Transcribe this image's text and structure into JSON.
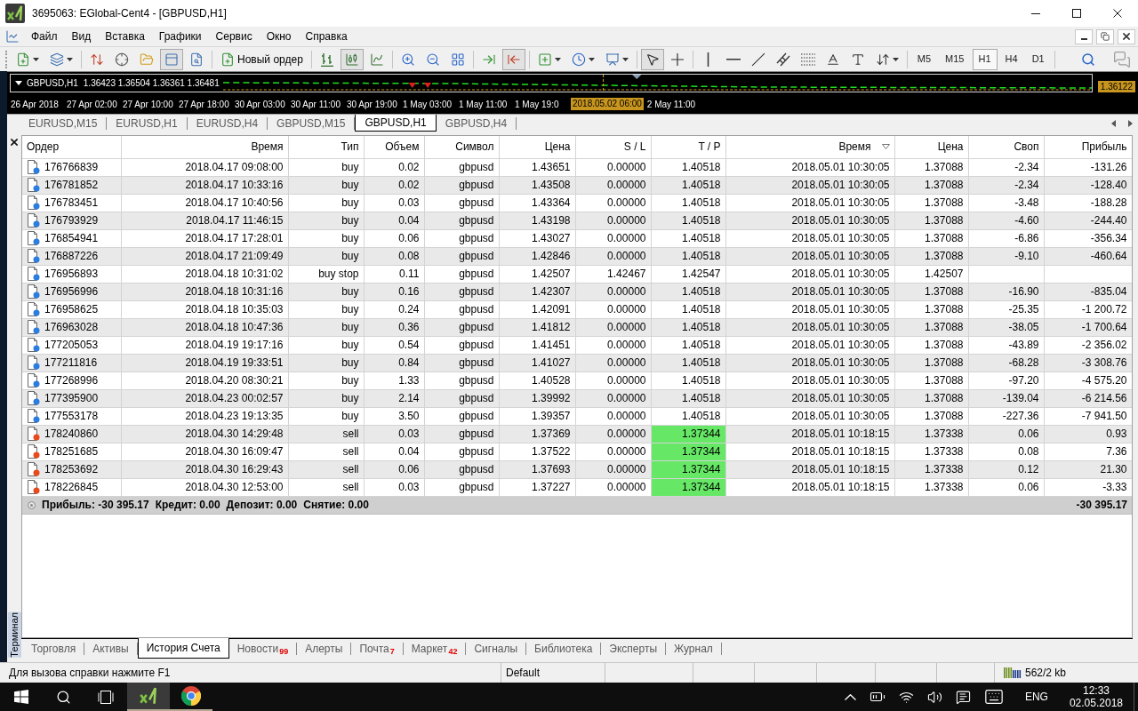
{
  "window": {
    "title": "3695063: EGlobal-Cent4 - [GBPUSD,H1]"
  },
  "menu": {
    "items": [
      "Файл",
      "Вид",
      "Вставка",
      "Графики",
      "Сервис",
      "Окно",
      "Справка"
    ]
  },
  "toolbar": {
    "groups": [
      [
        {
          "kind": "new-chart",
          "pressed": false,
          "dropdown": true
        },
        {
          "kind": "profiles",
          "pressed": false,
          "dropdown": true
        }
      ],
      [
        {
          "kind": "market-watch",
          "pressed": false,
          "dropdown": false
        },
        {
          "kind": "data-window",
          "pressed": false,
          "dropdown": false
        },
        {
          "kind": "navigator",
          "pressed": false,
          "dropdown": false
        },
        {
          "kind": "terminal",
          "pressed": true,
          "dropdown": false
        },
        {
          "kind": "tester",
          "pressed": false,
          "dropdown": false
        }
      ],
      [
        {
          "kind": "new-order",
          "label": "Новый ордер",
          "pressed": false,
          "dropdown": false
        }
      ],
      [
        {
          "kind": "bar-chart",
          "pressed": false,
          "dropdown": false
        },
        {
          "kind": "candles",
          "pressed": true,
          "dropdown": false
        },
        {
          "kind": "line-chart",
          "pressed": false,
          "dropdown": false
        }
      ],
      [
        {
          "kind": "zoom-in",
          "pressed": false,
          "dropdown": false
        },
        {
          "kind": "zoom-out",
          "pressed": false,
          "dropdown": false
        },
        {
          "kind": "tile",
          "pressed": false,
          "dropdown": false
        }
      ],
      [
        {
          "kind": "chart-shift",
          "pressed": false,
          "dropdown": false
        },
        {
          "kind": "autoscroll",
          "pressed": true,
          "dropdown": false
        }
      ],
      [
        {
          "kind": "indicators",
          "pressed": false,
          "dropdown": true
        },
        {
          "kind": "periods",
          "pressed": false,
          "dropdown": true
        },
        {
          "kind": "templates",
          "pressed": false,
          "dropdown": true
        }
      ],
      [
        {
          "kind": "cursor",
          "pressed": true,
          "dropdown": false
        },
        {
          "kind": "crosshair",
          "pressed": false,
          "dropdown": false
        }
      ],
      [
        {
          "kind": "vline",
          "pressed": false,
          "dropdown": false
        },
        {
          "kind": "hline",
          "pressed": false,
          "dropdown": false
        },
        {
          "kind": "trendline",
          "pressed": false,
          "dropdown": false
        },
        {
          "kind": "channel",
          "pressed": false,
          "dropdown": false
        },
        {
          "kind": "fibo",
          "pressed": false,
          "dropdown": false
        },
        {
          "kind": "text",
          "pressed": false,
          "dropdown": false
        },
        {
          "kind": "label",
          "pressed": false,
          "dropdown": false
        },
        {
          "kind": "arrows",
          "pressed": false,
          "dropdown": true
        }
      ]
    ],
    "timeframes": [
      {
        "label": "M5",
        "selected": false
      },
      {
        "label": "M15",
        "selected": false
      },
      {
        "label": "H1",
        "selected": true
      },
      {
        "label": "H4",
        "selected": false
      },
      {
        "label": "D1",
        "selected": false
      }
    ]
  },
  "chart": {
    "symbol": "GBPUSD,H1",
    "prices": "1.36423 1.36504 1.36361 1.36481",
    "price_tag": "1.36122",
    "time_labels": [
      "26 Apr 2018",
      "27 Apr 02:00",
      "27 Apr 10:00",
      "27 Apr 18:00",
      "30 Apr 03:00",
      "30 Apr 11:00",
      "30 Apr 19:00",
      "1 May 03:00",
      "1 May 11:00",
      "1 May 19:0"
    ],
    "cursor_time": "2018.05.02 06:00",
    "time_labels_after": [
      "2 May 11:00"
    ]
  },
  "chart_tabs": [
    {
      "label": "EURUSD,M15",
      "selected": false
    },
    {
      "label": "EURUSD,H1",
      "selected": false
    },
    {
      "label": "EURUSD,H4",
      "selected": false
    },
    {
      "label": "GBPUSD,M15",
      "selected": false
    },
    {
      "label": "GBPUSD,H1",
      "selected": true
    },
    {
      "label": "GBPUSD,H4",
      "selected": false
    }
  ],
  "terminal": {
    "title": "Терминал",
    "columns": [
      {
        "label": "Ордер",
        "sorted": false
      },
      {
        "label": "Время",
        "sorted": false
      },
      {
        "label": "Тип",
        "sorted": false
      },
      {
        "label": "Объем",
        "sorted": false
      },
      {
        "label": "Символ",
        "sorted": false
      },
      {
        "label": "Цена",
        "sorted": false
      },
      {
        "label": "S / L",
        "sorted": false
      },
      {
        "label": "T / P",
        "sorted": false
      },
      {
        "label": "Время",
        "sorted": true
      },
      {
        "label": "Цена",
        "sorted": false
      },
      {
        "label": "Своп",
        "sorted": false
      },
      {
        "label": "Прибыль",
        "sorted": false
      }
    ],
    "rows": [
      {
        "kind": "buy",
        "tp_highlighted": false,
        "cells": [
          "176766839",
          "2018.04.17 09:08:00",
          "buy",
          "0.02",
          "gbpusd",
          "1.43651",
          "0.00000",
          "1.40518",
          "2018.05.01 10:30:05",
          "1.37088",
          "-2.34",
          "-131.26"
        ]
      },
      {
        "kind": "buy",
        "tp_highlighted": false,
        "cells": [
          "176781852",
          "2018.04.17 10:33:16",
          "buy",
          "0.02",
          "gbpusd",
          "1.43508",
          "0.00000",
          "1.40518",
          "2018.05.01 10:30:05",
          "1.37088",
          "-2.34",
          "-128.40"
        ]
      },
      {
        "kind": "buy",
        "tp_highlighted": false,
        "cells": [
          "176783451",
          "2018.04.17 10:40:56",
          "buy",
          "0.03",
          "gbpusd",
          "1.43364",
          "0.00000",
          "1.40518",
          "2018.05.01 10:30:05",
          "1.37088",
          "-3.48",
          "-188.28"
        ]
      },
      {
        "kind": "buy",
        "tp_highlighted": false,
        "cells": [
          "176793929",
          "2018.04.17 11:46:15",
          "buy",
          "0.04",
          "gbpusd",
          "1.43198",
          "0.00000",
          "1.40518",
          "2018.05.01 10:30:05",
          "1.37088",
          "-4.60",
          "-244.40"
        ]
      },
      {
        "kind": "buy",
        "tp_highlighted": false,
        "cells": [
          "176854941",
          "2018.04.17 17:28:01",
          "buy",
          "0.06",
          "gbpusd",
          "1.43027",
          "0.00000",
          "1.40518",
          "2018.05.01 10:30:05",
          "1.37088",
          "-6.86",
          "-356.34"
        ]
      },
      {
        "kind": "buy",
        "tp_highlighted": false,
        "cells": [
          "176887226",
          "2018.04.17 21:09:49",
          "buy",
          "0.08",
          "gbpusd",
          "1.42846",
          "0.00000",
          "1.40518",
          "2018.05.01 10:30:05",
          "1.37088",
          "-9.10",
          "-460.64"
        ]
      },
      {
        "kind": "buy",
        "tp_highlighted": false,
        "cells": [
          "176956893",
          "2018.04.18 10:31:02",
          "buy stop",
          "0.11",
          "gbpusd",
          "1.42507",
          "1.42467",
          "1.42547",
          "2018.05.01 10:30:05",
          "1.42507"
        ]
      },
      {
        "kind": "buy",
        "tp_highlighted": false,
        "cells": [
          "176956996",
          "2018.04.18 10:31:16",
          "buy",
          "0.16",
          "gbpusd",
          "1.42307",
          "0.00000",
          "1.40518",
          "2018.05.01 10:30:05",
          "1.37088",
          "-16.90",
          "-835.04"
        ]
      },
      {
        "kind": "buy",
        "tp_highlighted": false,
        "cells": [
          "176958625",
          "2018.04.18 10:35:03",
          "buy",
          "0.24",
          "gbpusd",
          "1.42091",
          "0.00000",
          "1.40518",
          "2018.05.01 10:30:05",
          "1.37088",
          "-25.35",
          "-1 200.72"
        ]
      },
      {
        "kind": "buy",
        "tp_highlighted": false,
        "cells": [
          "176963028",
          "2018.04.18 10:47:36",
          "buy",
          "0.36",
          "gbpusd",
          "1.41812",
          "0.00000",
          "1.40518",
          "2018.05.01 10:30:05",
          "1.37088",
          "-38.05",
          "-1 700.64"
        ]
      },
      {
        "kind": "buy",
        "tp_highlighted": false,
        "cells": [
          "177205053",
          "2018.04.19 19:17:16",
          "buy",
          "0.54",
          "gbpusd",
          "1.41451",
          "0.00000",
          "1.40518",
          "2018.05.01 10:30:05",
          "1.37088",
          "-43.89",
          "-2 356.02"
        ]
      },
      {
        "kind": "buy",
        "tp_highlighted": false,
        "cells": [
          "177211816",
          "2018.04.19 19:33:51",
          "buy",
          "0.84",
          "gbpusd",
          "1.41027",
          "0.00000",
          "1.40518",
          "2018.05.01 10:30:05",
          "1.37088",
          "-68.28",
          "-3 308.76"
        ]
      },
      {
        "kind": "buy",
        "tp_highlighted": false,
        "cells": [
          "177268996",
          "2018.04.20 08:30:21",
          "buy",
          "1.33",
          "gbpusd",
          "1.40528",
          "0.00000",
          "1.40518",
          "2018.05.01 10:30:05",
          "1.37088",
          "-97.20",
          "-4 575.20"
        ]
      },
      {
        "kind": "buy",
        "tp_highlighted": false,
        "cells": [
          "177395900",
          "2018.04.23 00:02:57",
          "buy",
          "2.14",
          "gbpusd",
          "1.39992",
          "0.00000",
          "1.40518",
          "2018.05.01 10:30:05",
          "1.37088",
          "-139.04",
          "-6 214.56"
        ]
      },
      {
        "kind": "buy",
        "tp_highlighted": false,
        "cells": [
          "177553178",
          "2018.04.23 19:13:35",
          "buy",
          "3.50",
          "gbpusd",
          "1.39357",
          "0.00000",
          "1.40518",
          "2018.05.01 10:30:05",
          "1.37088",
          "-227.36",
          "-7 941.50"
        ]
      },
      {
        "kind": "sell",
        "tp_highlighted": true,
        "cells": [
          "178240860",
          "2018.04.30 14:29:48",
          "sell",
          "0.03",
          "gbpusd",
          "1.37369",
          "0.00000",
          "1.37344",
          "2018.05.01 10:18:15",
          "1.37338",
          "0.06",
          "0.93"
        ]
      },
      {
        "kind": "sell",
        "tp_highlighted": true,
        "cells": [
          "178251685",
          "2018.04.30 16:09:47",
          "sell",
          "0.04",
          "gbpusd",
          "1.37522",
          "0.00000",
          "1.37344",
          "2018.05.01 10:18:15",
          "1.37338",
          "0.08",
          "7.36"
        ]
      },
      {
        "kind": "sell",
        "tp_highlighted": true,
        "cells": [
          "178253692",
          "2018.04.30 16:29:43",
          "sell",
          "0.06",
          "gbpusd",
          "1.37693",
          "0.00000",
          "1.37344",
          "2018.05.01 10:18:15",
          "1.37338",
          "0.12",
          "21.30"
        ]
      },
      {
        "kind": "sell",
        "tp_highlighted": true,
        "cells": [
          "178226845",
          "2018.04.30 12:53:00",
          "sell",
          "0.03",
          "gbpusd",
          "1.37227",
          "0.00000",
          "1.37344",
          "2018.05.01 10:18:15",
          "1.37338",
          "0.06",
          "-3.33"
        ]
      }
    ],
    "summary": {
      "items": [
        "Прибыль: -30 395.17",
        "Кредит: 0.00",
        "Депозит: 0.00",
        "Снятие: 0.00"
      ],
      "total": "-30 395.17"
    },
    "tabs": [
      {
        "label": "Торговля",
        "selected": false
      },
      {
        "label": "Активы",
        "selected": false
      },
      {
        "label": "История Счета",
        "selected": true
      },
      {
        "label": "Новости",
        "badge": "99",
        "selected": false
      },
      {
        "label": "Алерты",
        "selected": false
      },
      {
        "label": "Почта",
        "badge": "7",
        "selected": false
      },
      {
        "label": "Маркет",
        "badge": "42",
        "selected": false
      },
      {
        "label": "Сигналы",
        "selected": false
      },
      {
        "label": "Библиотека",
        "selected": false
      },
      {
        "label": "Эксперты",
        "selected": false
      },
      {
        "label": "Журнал",
        "selected": false
      }
    ]
  },
  "status_bar": {
    "help": "Для вызова справки нажмите F1",
    "profile": "Default",
    "traffic": "562/2 kb"
  },
  "taskbar": {
    "apps": [
      {
        "kind": "metatrader",
        "active": true
      },
      {
        "kind": "browser",
        "active": false
      }
    ],
    "language": "ENG",
    "time": "12:33",
    "date": "02.05.2018"
  }
}
